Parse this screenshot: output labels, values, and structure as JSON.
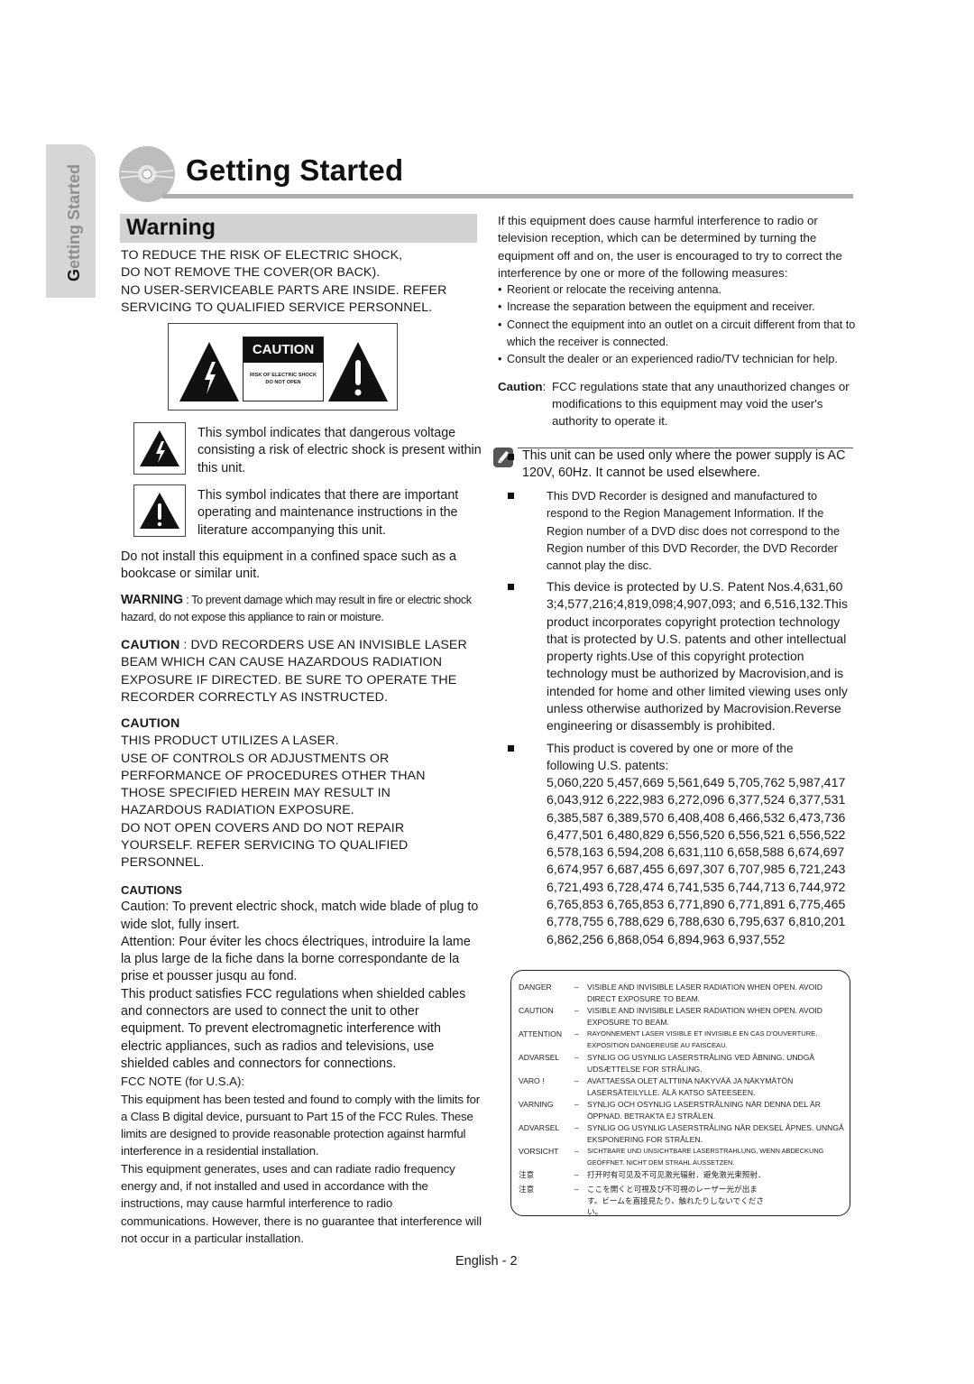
{
  "side_tab": {
    "first_letter": "G",
    "rest": "etting Started"
  },
  "header": {
    "title": "Getting Started",
    "disc_icon": "disc-icon"
  },
  "section": {
    "title": "Warning"
  },
  "left": {
    "intro_lines": [
      "TO REDUCE THE RISK OF ELECTRIC SHOCK,",
      "DO NOT REMOVE THE COVER(OR BACK).",
      "NO USER-SERVICEABLE PARTS ARE INSIDE. REFER",
      "SERVICING TO QUALIFIED SERVICE PERSONNEL."
    ],
    "caution_sign": {
      "heading": "CAUTION",
      "line1": "RISK OF ELECTRIC SHOCK",
      "line2": "DO NOT OPEN"
    },
    "symbols": [
      {
        "icon": "lightning-triangle-icon",
        "text": "This symbol indicates that dangerous voltage consisting a risk of electric shock is present within this unit."
      },
      {
        "icon": "exclamation-triangle-icon",
        "text": "This symbol indicates that there are important operating and maintenance instructions in the literature accompanying this unit."
      }
    ],
    "install_note": "Do not install this equipment in a confined space such as a bookcase or similar unit.",
    "warning": {
      "label": "WARNING",
      "text": " : To prevent damage which may result in fire or electric shock hazard, do not expose this appliance to rain or moisture."
    },
    "caution_laser": {
      "label": "CAUTION",
      "text": " : DVD RECORDERS USE AN INVISIBLE LASER BEAM WHICH CAN CAUSE HAZARDOUS RADIATION EXPOSURE IF DIRECTED. BE SURE TO OPERATE THE RECORDER CORRECTLY AS INSTRUCTED."
    },
    "caution_block": {
      "heading": "CAUTION",
      "lines": [
        "THIS PRODUCT UTILIZES A LASER.",
        "USE OF CONTROLS OR ADJUSTMENTS OR",
        "PERFORMANCE OF PROCEDURES OTHER THAN",
        "THOSE SPECIFIED HEREIN MAY RESULT IN",
        "HAZARDOUS RADIATION EXPOSURE.",
        "DO NOT OPEN COVERS AND DO NOT REPAIR",
        "YOURSELF. REFER SERVICING TO QUALIFIED",
        "PERSONNEL."
      ]
    },
    "cautions": {
      "heading": "CAUTIONS",
      "paragraphs": [
        "Caution: To prevent electric shock, match wide blade of plug to wide slot, fully insert.",
        "Attention: Pour éviter les chocs électriques, introduire la lame la plus large de la fiche dans la borne correspondante de la prise et pousser jusqu au fond.",
        "This product satisfies FCC regulations when shielded cables and connectors are used to connect the unit to other equipment. To prevent electromagnetic interference with electric appliances, such as radios and televisions, use shielded cables and connectors for connections.",
        "FCC NOTE (for U.S.A):",
        "This equipment has been tested and found to comply with the limits for a Class B digital device, pursuant to Part 15 of the FCC Rules. These limits are designed to provide reasonable protection against harmful interference in a residential installation.",
        "This equipment generates, uses and can radiate radio frequency energy and, if not installed and used in accordance with the instructions, may cause harmful interference to radio communications. However, there is no guarantee that interference will not occur in a particular installation."
      ]
    }
  },
  "right": {
    "intro": "If this equipment does cause harmful interference to radio or television reception, which can be determined by turning the equipment off and on, the user is encouraged to try to correct the interference by one or more of the following measures:",
    "measures": [
      "Reorient or relocate the receiving antenna.",
      "Increase the separation between the equipment and receiver.",
      "Connect the equipment into an outlet on a circuit different from that to which the receiver is connected.",
      "Consult the dealer or an experienced radio/TV technician for help."
    ],
    "fcc_caution": {
      "label": "Caution",
      "text": "FCC regulations state that any unauthorized changes or modifications to this equipment may void the user's authority to operate it."
    },
    "notes": [
      "This unit can be used only where the power supply is AC 120V, 60Hz. It cannot be used elsewhere.",
      "This DVD Recorder is designed and manufactured to respond to the Region Management Information. If the Region number of a DVD disc does not correspond to the Region number of this DVD Recorder, the DVD Recorder cannot play the disc.",
      "This device is protected by U.S. Patent Nos.4,631,60 3;4,577,216;4,819,098;4,907,093; and 6,516,132.This product incorporates copyright protection technology that is protected by U.S. patents and other intellectual property rights.Use of this copyright protection technology must be authorized by Macrovision,and is intended for home and other limited viewing uses only unless otherwise authorized by Macrovision.Reverse engineering or disassembly is prohibited.",
      "This product is covered by one or more of the following U.S. patents:"
    ],
    "patents": [
      "5,060,220 5,457,669 5,561,649 5,705,762 5,987,417",
      "6,043,912 6,222,983 6,272,096 6,377,524 6,377,531",
      "6,385,587 6,389,570 6,408,408 6,466,532 6,473,736",
      "6,477,501 6,480,829 6,556,520 6,556,521 6,556,522",
      "6,578,163 6,594,208 6,631,110 6,658,588 6,674,697",
      "6,674,957 6,687,455 6,697,307 6,707,985 6,721,243",
      "6,721,493 6,728,474 6,741,535 6,744,713 6,744,972",
      "6,765,853 6,765,853 6,771,890 6,771,891 6,775,465",
      "6,778,755 6,788,629 6,788,630 6,795,637 6,810,201",
      "6,862,256 6,868,054 6,894,963 6,937,552"
    ],
    "laser_label": [
      {
        "lang": "DANGER",
        "text": "VISIBLE AND INVISIBLE LASER RADIATION WHEN OPEN. AVOID DIRECT EXPOSURE TO BEAM."
      },
      {
        "lang": "CAUTION",
        "text": "VISIBLE AND INVISIBLE LASER RADIATION WHEN OPEN. AVOID EXPOSURE TO BEAM."
      },
      {
        "lang": "ATTENTION",
        "text": "RAYONNEMENT LASER VISIBLE ET INVISIBLE EN CAS D'OUVERTURE. EXPOSITION DANGEREUSE AU FAISCEAU."
      },
      {
        "lang": "ADVARSEL",
        "text": "SYNLIG OG USYNLIG LASERSTRÅLING VED ÅBNING. UNDGÅ UDSÆTTELSE FOR STRÅLING."
      },
      {
        "lang": "VARO !",
        "text": "AVATTAESSA OLET ALTTIINA NÄKYVÄÄ JA NÄKYMÄTÖN LASERSÄTEILYLLE. ÄLÄ KATSO SÄTEESEEN."
      },
      {
        "lang": "VARNING",
        "text": "SYNLIG OCH OSYNLIG LASERSTRÅLNING NÄR DENNA DEL ÄR ÖPPNAD. BETRAKTA EJ STRÅLEN."
      },
      {
        "lang": "ADVARSEL",
        "text": "SYNLIG OG USYNLIG LASERSTRÅLING NÅR DEKSEL ÅPNES. UNNGÅ EKSPONERING FOR STRÅLEN."
      },
      {
        "lang": "VORSICHT",
        "text": "SICHTBARE UND UNSICHTBARE LASERSTRAHLUNG, WENN ABDECKUNG GEÖFFNET. NICHT DEM STRAHL AUSSETZEN."
      },
      {
        "lang": "注意",
        "text": "打开时有可见及不可见激光辐射．避免激光束照射．"
      },
      {
        "lang": "注意",
        "text": "ここを開くと可視及び不可視のレーザー光が出ます。ビームを直接見たり、触れたりしないでください。"
      }
    ],
    "dash": "–"
  },
  "footer": {
    "page_label": "English - 2"
  }
}
